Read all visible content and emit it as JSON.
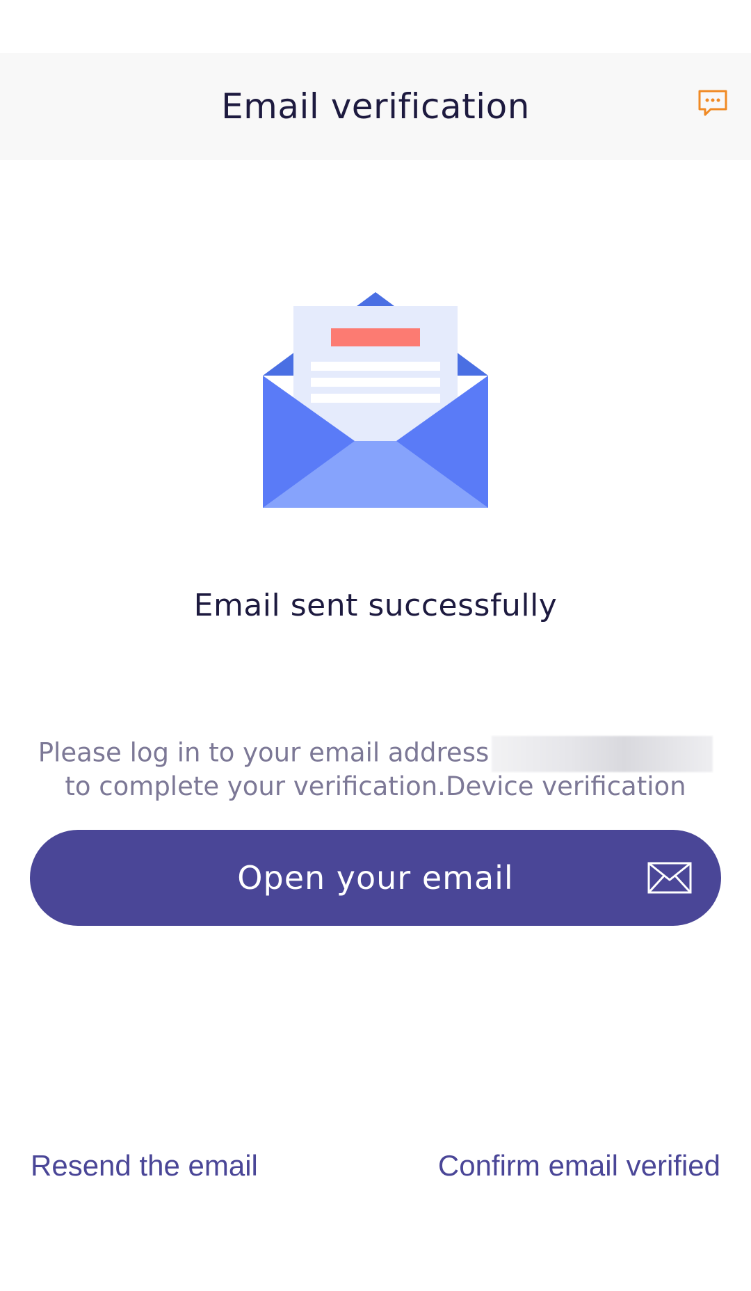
{
  "header": {
    "title": "Email verification",
    "chat_icon": "chat-bubble-icon"
  },
  "illustration": {
    "icon": "open-envelope-icon",
    "colors": {
      "flap": "#4a6fe3",
      "body": "#5a7bf7",
      "bottom": "#86a3fc",
      "letter": "#e5ebfc",
      "letter_bar": "#fc7b72"
    }
  },
  "main": {
    "status_title": "Email sent successfully",
    "description_line1": "Please log in to your email address",
    "description_line2": "to complete your verification.Device verification",
    "open_button_label": "Open your email",
    "open_button_icon": "mail-icon"
  },
  "footer": {
    "resend_label": "Resend the email",
    "confirm_label": "Confirm email verified"
  },
  "colors": {
    "accent": "#4a4697",
    "chat_icon": "#f08a24",
    "title_text": "#1d1a3f",
    "muted_text": "#7c7896",
    "header_bg": "#f8f8f8"
  }
}
